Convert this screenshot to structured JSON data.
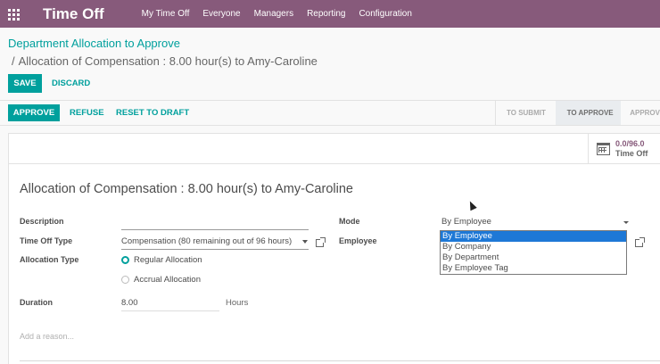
{
  "navbar": {
    "app_name": "Time Off",
    "menu": [
      "My Time Off",
      "Everyone",
      "Managers",
      "Reporting",
      "Configuration"
    ]
  },
  "breadcrumb": {
    "parent": "Department Allocation to Approve",
    "separator": "/",
    "current": "Allocation of Compensation : 8.00 hour(s) to Amy-Caroline"
  },
  "controls": {
    "save_label": "SAVE",
    "discard_label": "DISCARD"
  },
  "header_buttons": {
    "approve": "APPROVE",
    "refuse": "REFUSE",
    "reset": "RESET TO DRAFT"
  },
  "statusbar": {
    "stages": [
      "TO SUBMIT",
      "TO APPROVE",
      "APPROV"
    ],
    "active_index": 1
  },
  "smart_button": {
    "value": "0.0/96.0",
    "label": "Time Off",
    "icon": "calendar-icon"
  },
  "form": {
    "title": "Allocation of Compensation : 8.00 hour(s) to Amy-Caroline",
    "description_label": "Description",
    "description_value": "",
    "time_off_type_label": "Time Off Type",
    "time_off_type_value": "Compensation (80 remaining out of 96 hours)",
    "allocation_type_label": "Allocation Type",
    "allocation_options": [
      "Regular Allocation",
      "Accrual Allocation"
    ],
    "allocation_selected": "Regular Allocation",
    "duration_label": "Duration",
    "duration_value": "8.00",
    "duration_unit": "Hours",
    "mode_label": "Mode",
    "mode_value": "By Employee",
    "employee_label": "Employee",
    "reason_placeholder": "Add a reason..."
  },
  "mode_dropdown": {
    "options": [
      "By Employee",
      "By Company",
      "By Department",
      "By Employee Tag"
    ],
    "selected": "By Employee"
  },
  "colors": {
    "navbar": "#875a7b",
    "primary": "#00a09d",
    "dropdown_highlight": "#1e78d6"
  }
}
